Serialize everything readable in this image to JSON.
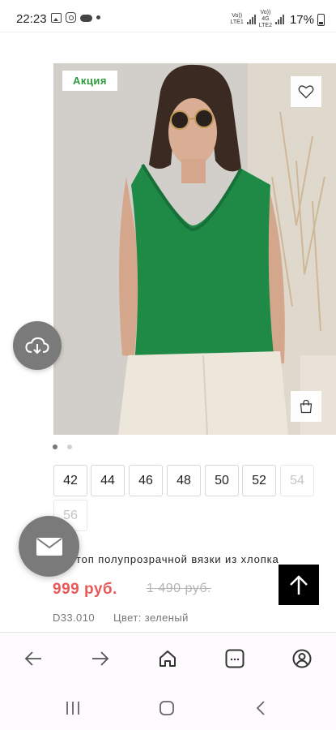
{
  "status_bar": {
    "time": "22:23",
    "net1": "Vo))\nLTE1",
    "net2_top": "Vo))",
    "net2_mid": "4G",
    "net2_bottom": "LTE2",
    "net1_top": "Vo))",
    "net1_bottom": "LTE1",
    "battery": "17%"
  },
  "product": {
    "badge": "Акция",
    "image_dots": {
      "count": 2,
      "active": 1
    },
    "sizes": [
      {
        "label": "42",
        "available": true
      },
      {
        "label": "44",
        "available": true
      },
      {
        "label": "46",
        "available": true
      },
      {
        "label": "48",
        "available": true
      },
      {
        "label": "50",
        "available": true
      },
      {
        "label": "52",
        "available": true
      },
      {
        "label": "54",
        "available": false
      },
      {
        "label": "56",
        "available": false
      }
    ],
    "title": "ний топ полупрозрачной вязки из хлопка",
    "price": "999 руб.",
    "old_price": "1 490 руб.",
    "sku": "D33.010",
    "color": "Цвет: зеленый"
  },
  "colors": {
    "badge_text": "#2e9a3e",
    "price": "#e85a5a",
    "top_green": "#1f8a45"
  },
  "icons": {
    "favorite": "heart-icon",
    "cart": "shopping-bag-icon",
    "cloud": "cloud-download-icon",
    "mail": "mail-icon",
    "scroll_top": "arrow-up-icon",
    "back": "arrow-left-icon",
    "forward": "arrow-right-icon",
    "home": "home-icon",
    "tabs": "tabs-icon",
    "account": "account-icon"
  }
}
